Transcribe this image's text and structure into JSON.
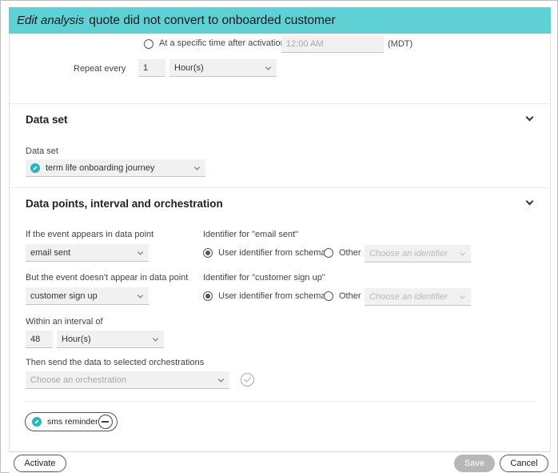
{
  "header": {
    "prefix": "Edit analysis",
    "analysis_name": "quote did not convert to onboarded customer"
  },
  "schedule": {
    "specific_time_label": "At a specific time after activation",
    "time_value": "12:00 AM",
    "timezone": "(MDT)",
    "repeat_label": "Repeat every",
    "repeat_value": "1",
    "repeat_unit": "Hour(s)"
  },
  "data_set_section": {
    "title": "Data set",
    "field_label": "Data set",
    "selected": "term life onboarding journey"
  },
  "data_points_section": {
    "title": "Data points, interval and orchestration",
    "appears_label": "If the event appears in data point",
    "appears_value": "email sent",
    "identifier_appears_label": "Identifier for \"email sent\"",
    "user_identifier_label": "User identifier from schema",
    "other_label": "Other",
    "choose_identifier_placeholder": "Choose an identifier",
    "not_appears_label": "But the event doesn't appear in data point",
    "not_appears_value": "customer sign up",
    "identifier_not_appears_label": "Identifier for \"customer sign up\"",
    "interval_label": "Within an interval of",
    "interval_value": "48",
    "interval_unit": "Hour(s)",
    "orchestration_label": "Then send the data to selected orchestrations",
    "orchestration_placeholder": "Choose an orchestration",
    "selected_orchestrations": [
      "sms reminder"
    ]
  },
  "footer": {
    "activate_label": "Activate",
    "save_label": "Save",
    "cancel_label": "Cancel"
  },
  "colors": {
    "header_bg": "#5fd0d3",
    "accent_icon": "#2bb3c0"
  }
}
